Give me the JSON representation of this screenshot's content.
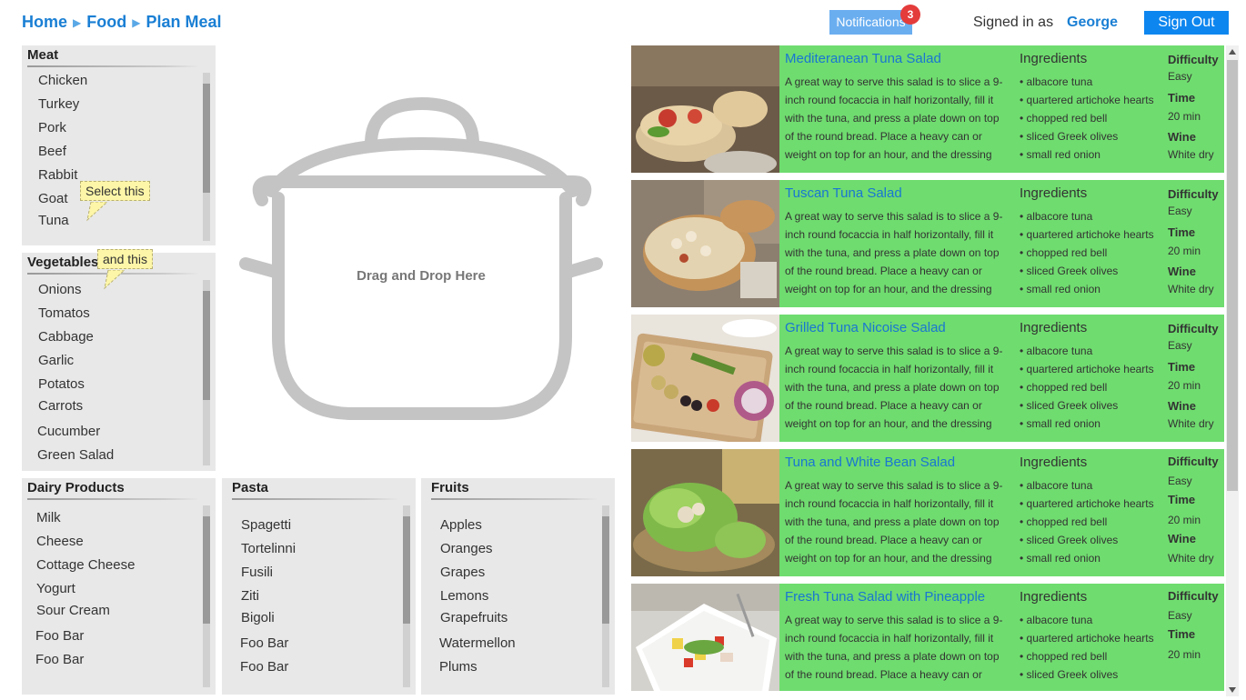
{
  "breadcrumb": [
    "Home",
    "Food",
    "Plan Meal"
  ],
  "header": {
    "notifications_label": "Notifications",
    "notifications_count": "3",
    "signed_in_label": "Signed in as",
    "user_name": "George",
    "sign_out_label": "Sign Out"
  },
  "categories": {
    "meat": {
      "title": "Meat",
      "items": [
        "Chicken",
        "Turkey",
        "Pork",
        "Beef",
        "Rabbit",
        "Goat",
        "Tuna"
      ]
    },
    "vegetables": {
      "title": "Vegetables",
      "items": [
        "Onions",
        "Tomatos",
        "Cabbage",
        "Garlic",
        "Potatos",
        "Carrots",
        "Cucumber",
        "Green Salad"
      ]
    },
    "dairy": {
      "title": "Dairy Products",
      "items": [
        "Milk",
        "Cheese",
        "Cottage Cheese",
        "Yogurt",
        "Sour Cream",
        "Foo Bar",
        "Foo Bar"
      ]
    },
    "pasta": {
      "title": "Pasta",
      "items": [
        "Spagetti",
        "Tortelinni",
        "Fusili",
        "Ziti",
        "Bigoli",
        "Foo Bar",
        "Foo Bar"
      ]
    },
    "fruits": {
      "title": "Fruits",
      "items": [
        "Apples",
        "Oranges",
        "Grapes",
        "Lemons",
        "Grapefruits",
        "Watermellon",
        "Plums"
      ]
    }
  },
  "tooltips": {
    "first": "Select this",
    "second": "and this"
  },
  "pot": {
    "label": "Drag and Drop Here"
  },
  "recipe_labels": {
    "ingredients": "Ingredients",
    "difficulty": "Difficulty",
    "time": "Time",
    "wine": "Wine"
  },
  "recipes": [
    {
      "title": "Mediteranean Tuna Salad",
      "description": "A great way to serve this salad is to slice a 9-inch round focaccia in half horizontally, fill it with the tuna, and press a plate down on top of the round bread. Place a heavy can or weight on top for an hour, and the dressing",
      "ingredients": [
        "• albacore tuna",
        "• quartered artichoke hearts",
        "• chopped red bell",
        "• sliced Greek olives",
        "• small red onion"
      ],
      "difficulty": "Easy",
      "time": "20 min",
      "wine": "White dry"
    },
    {
      "title": "Tuscan Tuna Salad",
      "description": "A great way to serve this salad is to slice a 9-inch round focaccia in half horizontally, fill it with the tuna, and press a plate down on top of the round bread. Place a heavy can or weight on top for an hour, and the dressing",
      "ingredients": [
        "• albacore tuna",
        "• quartered artichoke hearts",
        "• chopped red bell",
        "• sliced Greek olives",
        "• small red onion"
      ],
      "difficulty": "Easy",
      "time": "20 min",
      "wine": "White dry"
    },
    {
      "title": "Grilled Tuna Nicoise Salad",
      "description": "A great way to serve this salad is to slice a 9-inch round focaccia in half horizontally, fill it with the tuna, and press a plate down on top of the round bread. Place a heavy can or weight on top for an hour, and the dressing",
      "ingredients": [
        "• albacore tuna",
        "• quartered artichoke hearts",
        "• chopped red bell",
        "• sliced Greek olives",
        "• small red onion"
      ],
      "difficulty": "Easy",
      "time": "20 min",
      "wine": "White dry"
    },
    {
      "title": "Tuna and White Bean Salad",
      "description": "A great way to serve this salad is to slice a 9-inch round focaccia in half horizontally, fill it with the tuna, and press a plate down on top of the round bread. Place a heavy can or weight on top for an hour, and the dressing",
      "ingredients": [
        "• albacore tuna",
        "• quartered artichoke hearts",
        "• chopped red bell",
        "• sliced Greek olives",
        "• small red onion"
      ],
      "difficulty": "Easy",
      "time": "20 min",
      "wine": "White dry"
    },
    {
      "title": "Fresh Tuna Salad with Pineapple",
      "description": "A great way to serve this salad is to slice a 9-inch round focaccia in half horizontally, fill it with the tuna, and press a plate down on top of the round bread. Place a heavy can or",
      "ingredients": [
        "• albacore tuna",
        "• quartered artichoke hearts",
        "• chopped red bell",
        "• sliced Greek olives"
      ],
      "difficulty": "Easy",
      "time": "20 min",
      "wine": ""
    }
  ],
  "colors": {
    "accent": "#1a7fd4",
    "recipe_bg": "#6fdc6f",
    "panel_bg": "#e8e8e8",
    "signout": "#0e86ef"
  }
}
